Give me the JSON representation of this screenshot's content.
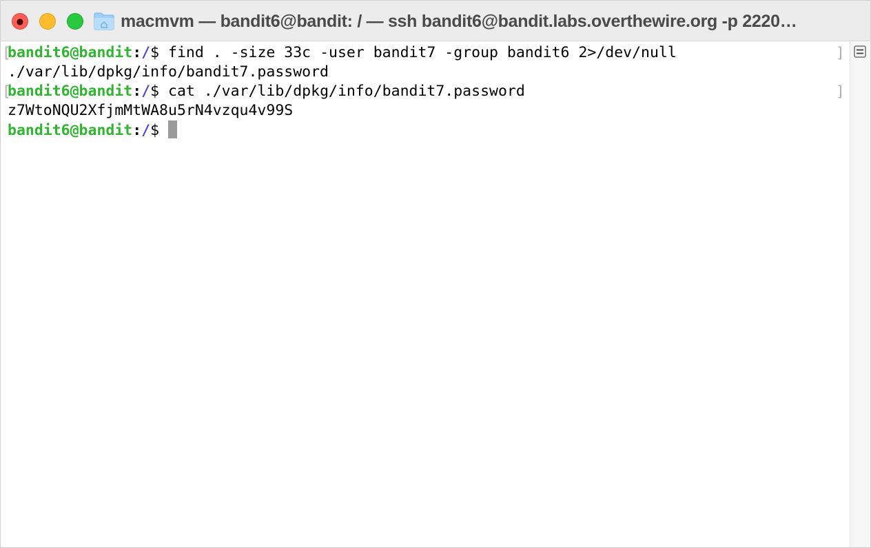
{
  "window": {
    "title": "macmvm — bandit6@bandit: / — ssh bandit6@bandit.labs.overthewire.org -p 2220…",
    "traffic_lights": {
      "close": "close-icon",
      "minimize": "minimize-icon",
      "zoom": "zoom-icon"
    },
    "title_icon": "folder-icon"
  },
  "terminal": {
    "prompt": {
      "user_host": "bandit6@bandit",
      "colon": ":",
      "dir": "/",
      "symbol": "$"
    },
    "lines": [
      {
        "type": "command",
        "text": " find . -size 33c -user bandit7 -group bandit6 2>/dev/null",
        "left_mark": "[",
        "right_mark": "]"
      },
      {
        "type": "output",
        "text": "./var/lib/dpkg/info/bandit7.password"
      },
      {
        "type": "command",
        "text": " cat ./var/lib/dpkg/info/bandit7.password",
        "left_mark": "[",
        "right_mark": "]"
      },
      {
        "type": "output",
        "text": "z7WtoNQU2XfjmMtWA8u5rN4vzqu4v99S"
      },
      {
        "type": "prompt",
        "text": " "
      }
    ]
  },
  "colors": {
    "prompt_user": "#2fb52f",
    "prompt_dir": "#5a3fd6",
    "cursor": "#9a9a9a",
    "titlebar": "#ececec"
  },
  "scrollbar": {
    "menu_icon": "scrollbar-menu-icon"
  }
}
